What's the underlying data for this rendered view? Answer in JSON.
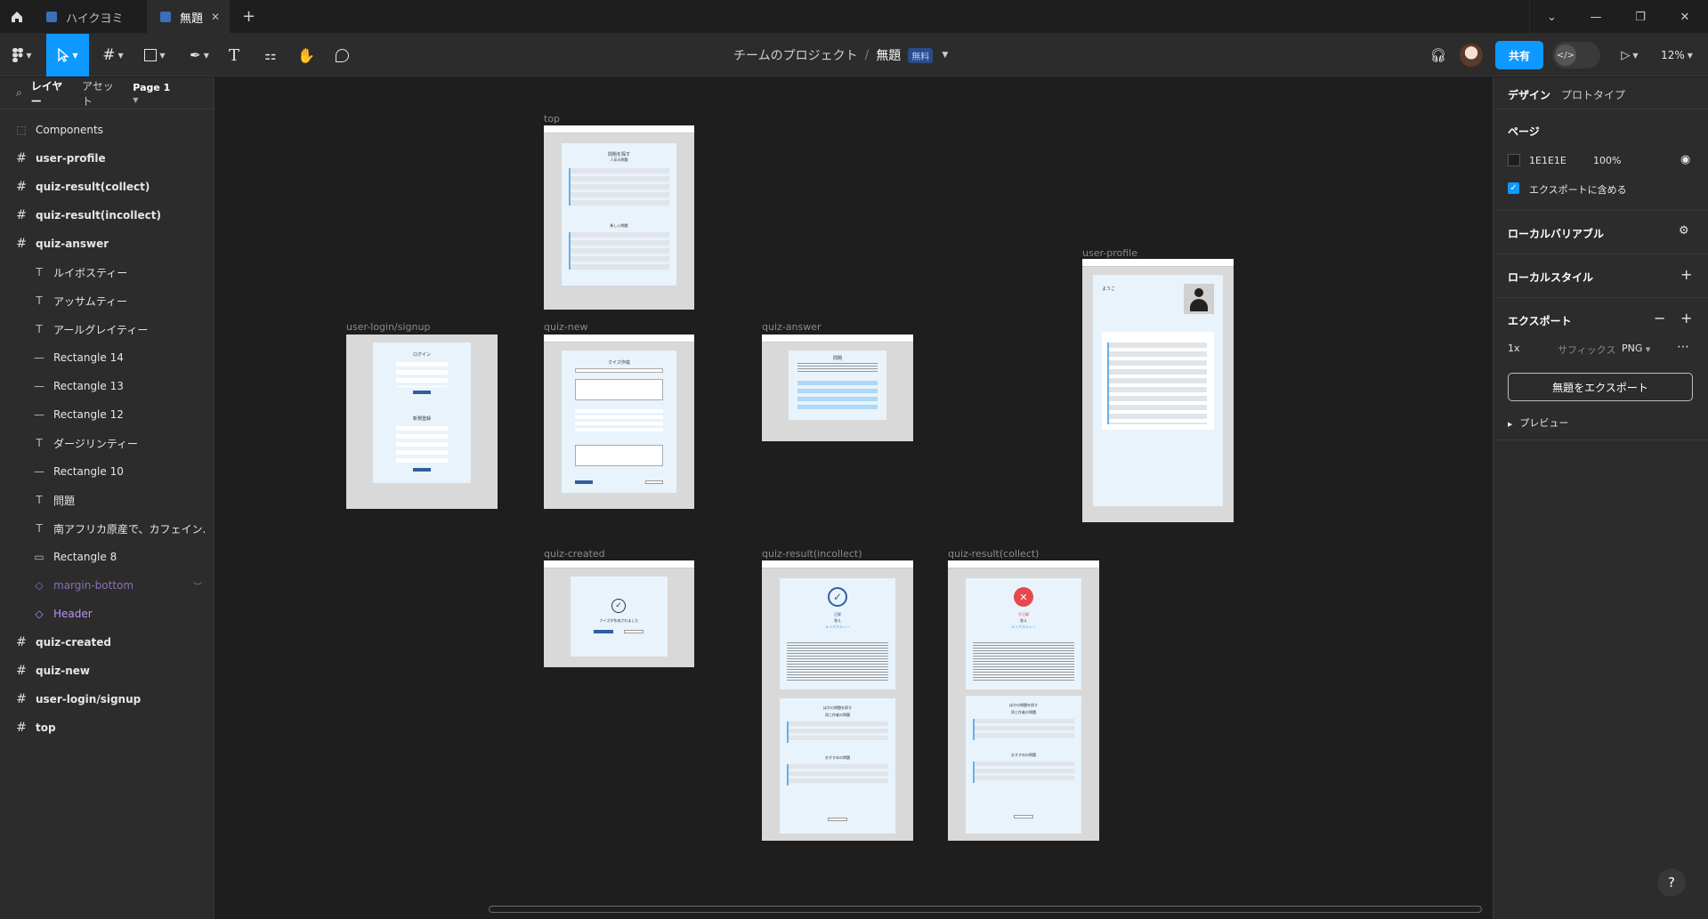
{
  "tabs": [
    {
      "label": "ハイクヨミ",
      "active": false
    },
    {
      "label": "無題",
      "active": true
    }
  ],
  "toolbar": {
    "project": "チームのプロジェクト",
    "file": "無題",
    "plan_badge": "無料",
    "share_label": "共有",
    "zoom": "12%",
    "devmode_icon": "</>"
  },
  "left_panel": {
    "tab_layers": "レイヤー",
    "tab_assets": "アセット",
    "page": "Page 1",
    "layers": [
      {
        "label": "Components",
        "kind": "section",
        "icon": "section-icon"
      },
      {
        "label": "user-profile",
        "kind": "frame",
        "icon": "frame-icon"
      },
      {
        "label": "quiz-result(collect)",
        "kind": "frame",
        "icon": "frame-icon"
      },
      {
        "label": "quiz-result(incollect)",
        "kind": "frame",
        "icon": "frame-icon"
      },
      {
        "label": "quiz-answer",
        "kind": "frame",
        "icon": "frame-icon"
      },
      {
        "label": "ルイボスティー",
        "kind": "text",
        "icon": "text-icon"
      },
      {
        "label": "アッサムティー",
        "kind": "text",
        "icon": "text-icon"
      },
      {
        "label": "アールグレイティー",
        "kind": "text",
        "icon": "text-icon"
      },
      {
        "label": "Rectangle 14",
        "kind": "rect",
        "icon": "line-icon"
      },
      {
        "label": "Rectangle 13",
        "kind": "rect",
        "icon": "line-icon"
      },
      {
        "label": "Rectangle 12",
        "kind": "rect",
        "icon": "line-icon"
      },
      {
        "label": "ダージリンティー",
        "kind": "text",
        "icon": "text-icon"
      },
      {
        "label": "Rectangle 10",
        "kind": "rect",
        "icon": "line-icon"
      },
      {
        "label": "問題",
        "kind": "text",
        "icon": "text-icon"
      },
      {
        "label": "南アフリカ原産で、カフェイン...",
        "kind": "text",
        "icon": "text-icon"
      },
      {
        "label": "Rectangle 8",
        "kind": "rect",
        "icon": "rectangle-icon"
      },
      {
        "label": "margin-bottom",
        "kind": "hidden",
        "icon": "component-icon"
      },
      {
        "label": "Header",
        "kind": "comp",
        "icon": "component-icon"
      },
      {
        "label": "quiz-created",
        "kind": "frame",
        "icon": "frame-icon"
      },
      {
        "label": "quiz-new",
        "kind": "frame",
        "icon": "frame-icon"
      },
      {
        "label": "user-login/signup",
        "kind": "frame",
        "icon": "frame-icon"
      },
      {
        "label": "top",
        "kind": "frame",
        "icon": "frame-icon"
      }
    ]
  },
  "canvas": {
    "frames": [
      {
        "label": "top"
      },
      {
        "label": "user-login/signup"
      },
      {
        "label": "quiz-new"
      },
      {
        "label": "quiz-answer"
      },
      {
        "label": "user-profile"
      },
      {
        "label": "quiz-created"
      },
      {
        "label": "quiz-result(incollect)"
      },
      {
        "label": "quiz-result(collect)"
      }
    ],
    "mini_text": {
      "top_title": "問題を探す",
      "top_popular": "人気の問題",
      "top_new": "新しい問題",
      "login": "ログイン",
      "signup": "新規登録",
      "quiz_new": "クイズ作成",
      "answer_title": "問題",
      "created_msg": "クイズが作成されました",
      "profile_greet": "ようこ",
      "result_correct": "正解",
      "result_wrong": "不正解",
      "answer_word": "答え",
      "answer_value": "ルイボスティー",
      "other_quiz": "ほかの問題を探す",
      "same_author": "同じ作者の問題",
      "recommended": "おすすめの問題"
    }
  },
  "right_panel": {
    "tab_design": "デザイン",
    "tab_prototype": "プロトタイプ",
    "page_title": "ページ",
    "page_color": "1E1E1E",
    "page_opacity": "100%",
    "include_export": "エクスポートに含める",
    "local_variables": "ローカルバリアブル",
    "local_styles": "ローカルスタイル",
    "export_title": "エクスポート",
    "scale": "1x",
    "suffix_placeholder": "サフィックス",
    "format": "PNG",
    "export_button": "無題をエクスポート",
    "preview": "プレビュー"
  },
  "help": "?"
}
